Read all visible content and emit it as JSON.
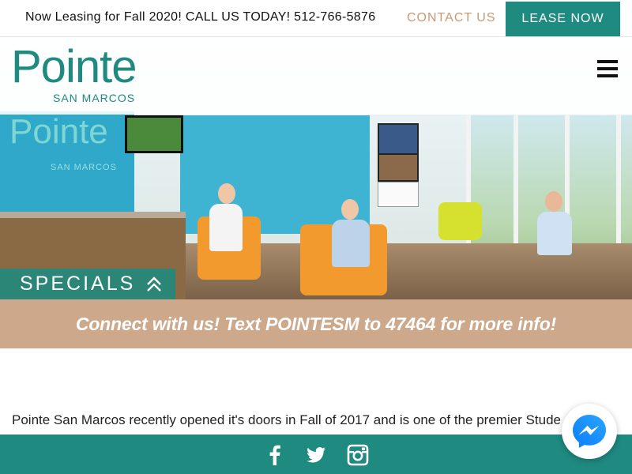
{
  "topbar": {
    "leasing_text": "Now Leasing for Fall 2020! CALL US TODAY! 512-766-5876",
    "contact_label": "CONTACT US",
    "lease_label": "LEASE NOW"
  },
  "logo": {
    "name": "Pointe",
    "sub": "SAN MARCOS"
  },
  "hero": {
    "wall_logo": "Pointe",
    "wall_sub": "SAN MARCOS"
  },
  "specials": {
    "label": "SPECIALS",
    "icon": "double-chevron-up-icon"
  },
  "connect": {
    "text": "Connect with us! Text POINTESM to 47464 for more info!"
  },
  "intro": {
    "text": "Pointe San Marcos recently opened it's doors in Fall of 2017 and is one of the premier Stude"
  },
  "footer": {
    "icons": [
      "facebook-icon",
      "twitter-icon",
      "instagram-icon"
    ]
  },
  "colors": {
    "teal": "#1f8a80",
    "tan": "#cda88a",
    "contact": "#c89a74"
  }
}
